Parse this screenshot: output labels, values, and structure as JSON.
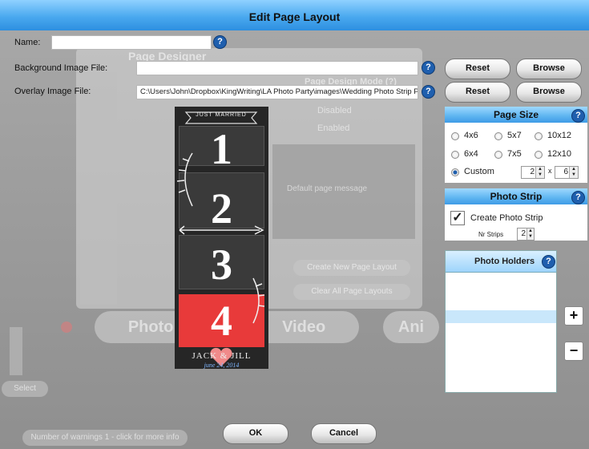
{
  "window": {
    "title": "Edit Page Layout"
  },
  "form": {
    "name_label": "Name:",
    "name_value": "",
    "bg_label": "Background Image File:",
    "bg_value": "",
    "overlay_label": "Overlay Image File:",
    "overlay_value": "C:\\Users\\John\\Dropbox\\KingWriting\\LA Photo Party\\images\\Wedding Photo Strip Page Design"
  },
  "buttons": {
    "reset": "Reset",
    "browse": "Browse",
    "ok": "OK",
    "cancel": "Cancel",
    "plus": "+",
    "minus": "−"
  },
  "page_size": {
    "title": "Page Size",
    "options": [
      "4x6",
      "5x7",
      "10x12",
      "6x4",
      "7x5",
      "12x10",
      "Custom"
    ],
    "selected": "Custom",
    "custom_w": "2",
    "custom_x": "x",
    "custom_h": "6"
  },
  "photo_strip": {
    "title": "Photo Strip",
    "create_label": "Create Photo Strip",
    "create_checked": true,
    "nr_strips_label": "Nr Strips",
    "nr_strips": "2"
  },
  "photo_holders": {
    "title": "Photo Holders"
  },
  "strip_art": {
    "banner": "JUST MARRIED",
    "numbers": [
      "1",
      "2",
      "3",
      "4"
    ],
    "names": "JACK & JILL",
    "date": "june 24, 2014"
  },
  "background": {
    "page_designer": "Page Designer",
    "page_design_mode": "Page Design Mode (?)",
    "disabled": "Disabled",
    "enabled": "Enabled",
    "default_message": "Default page message",
    "create_new": "Create New Page Layout",
    "clear_all": "Clear All Page Layouts",
    "photo_tab": "Photo",
    "video_tab": "Video",
    "anim_tab": "Ani",
    "select": "Select",
    "warnings": "Number of warnings 1 - click for more info"
  },
  "colors": {
    "title_blue": "#4aa9ef",
    "help_blue": "#1f5fae",
    "strip_red": "#e83a3a",
    "heart_pink": "#f08a8a"
  }
}
